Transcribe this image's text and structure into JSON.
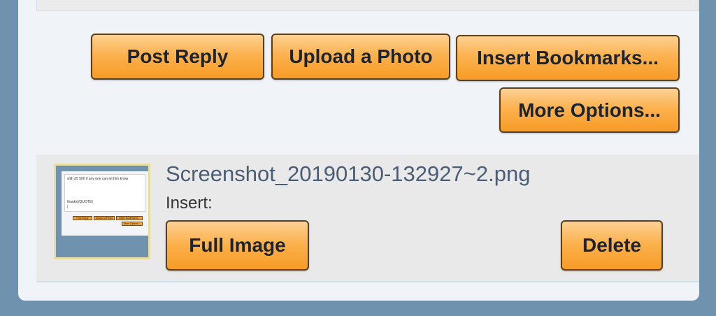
{
  "actions": {
    "post_reply": "Post Reply",
    "upload_photo": "Upload a Photo",
    "insert_bookmarks": "Insert Bookmarks...",
    "more_options": "More Options..."
  },
  "attachment": {
    "filename": "Screenshot_20190130-132927~2.png",
    "insert_label": "Insert:",
    "full_image": "Full Image",
    "delete": "Delete",
    "thumbnail": {
      "line1": "with £5 500 if any one can let him know",
      "line2": "thanks[/QUOTE]",
      "line3": "|",
      "post_reply": "Post Reply",
      "upload_photo": "Upload a Photo",
      "insert_bookmarks": "Insert Bookmarks...",
      "more_options": "More Options..."
    }
  }
}
